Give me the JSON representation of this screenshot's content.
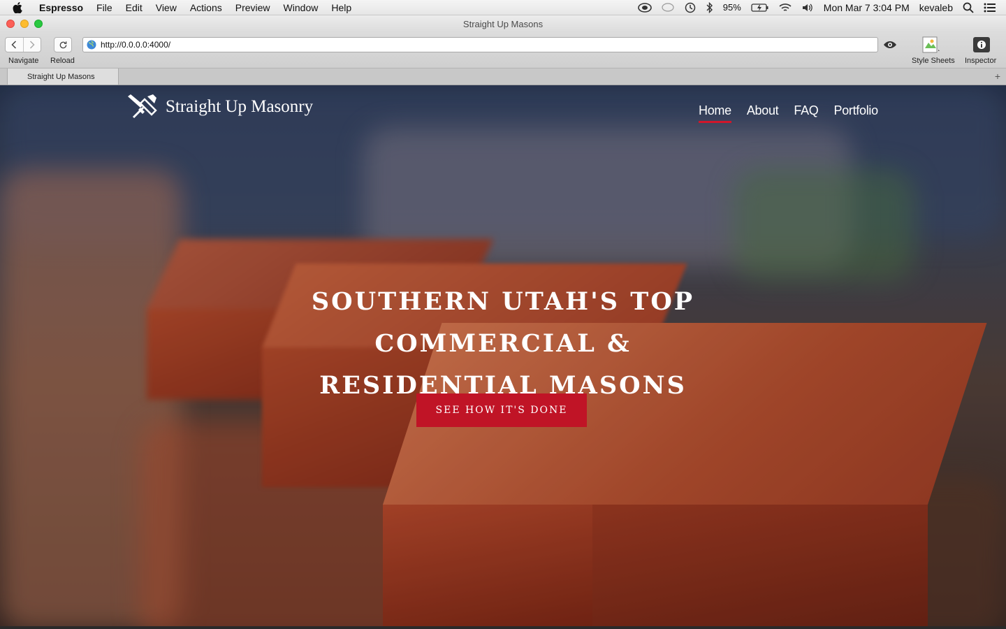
{
  "menubar": {
    "app_name": "Espresso",
    "items": [
      "File",
      "Edit",
      "View",
      "Actions",
      "Preview",
      "Window",
      "Help"
    ],
    "battery": "95%",
    "clock": "Mon Mar 7  3:04 PM",
    "user": "kevaleb"
  },
  "window": {
    "title": "Straight Up Masons"
  },
  "toolbar": {
    "navigate_label": "Navigate",
    "reload_label": "Reload",
    "url": "http://0.0.0.0:4000/",
    "style_sheets_label": "Style Sheets",
    "inspector_label": "Inspector"
  },
  "tabs": [
    {
      "label": "Straight Up Masons"
    }
  ],
  "site": {
    "logo_text": "Straight Up Masonry",
    "nav": [
      {
        "label": "Home",
        "active": true
      },
      {
        "label": "About",
        "active": false
      },
      {
        "label": "FAQ",
        "active": false
      },
      {
        "label": "Portfolio",
        "active": false
      }
    ],
    "hero_line1": "SOUTHERN UTAH'S TOP COMMERCIAL &",
    "hero_line2": "RESIDENTIAL MASONS",
    "cta_label": "SEE HOW IT'S DONE"
  },
  "colors": {
    "accent": "#c01426",
    "nav_active_underline": "#d0162b"
  }
}
